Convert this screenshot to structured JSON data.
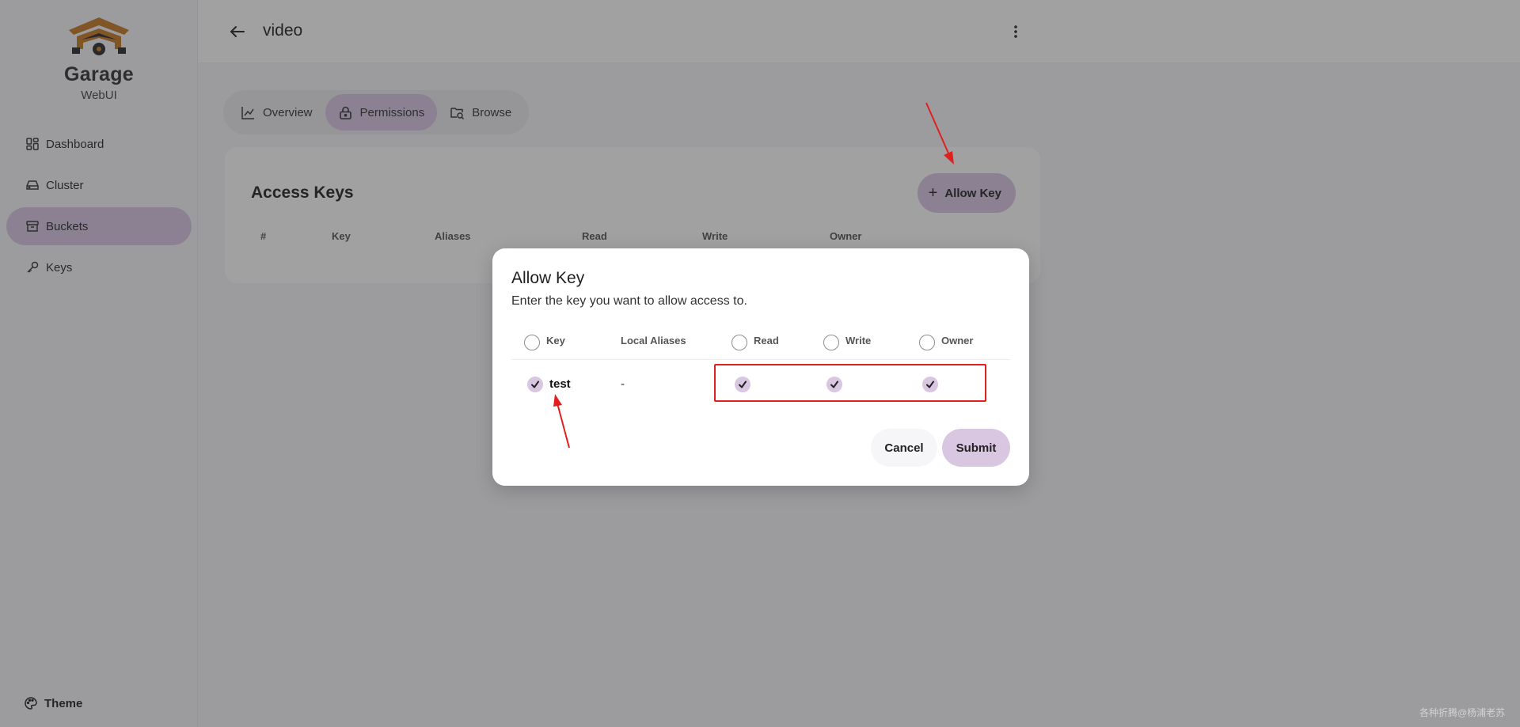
{
  "app": {
    "name": "Garage",
    "subtitle": "WebUI",
    "brand_color": "#c57a22",
    "accent_color": "#d9c7e2"
  },
  "sidebar": {
    "items": [
      {
        "label": "Dashboard",
        "icon": "dashboard-icon",
        "active": false
      },
      {
        "label": "Cluster",
        "icon": "hard-drive-icon",
        "active": false
      },
      {
        "label": "Buckets",
        "icon": "archive-box-icon",
        "active": true
      },
      {
        "label": "Keys",
        "icon": "key-icon",
        "active": false
      }
    ],
    "theme_label": "Theme",
    "theme_icon": "palette-icon"
  },
  "header": {
    "title": "video",
    "back_icon": "arrow-left-icon",
    "menu_icon": "more-vertical-icon"
  },
  "tabs": [
    {
      "label": "Overview",
      "icon": "chart-line-icon",
      "active": false
    },
    {
      "label": "Permissions",
      "icon": "lock-icon",
      "active": true
    },
    {
      "label": "Browse",
      "icon": "folder-search-icon",
      "active": false
    }
  ],
  "access_keys": {
    "title": "Access Keys",
    "allow_button_label": "Allow Key",
    "columns": [
      "#",
      "Key",
      "Aliases",
      "Read",
      "Write",
      "Owner"
    ]
  },
  "dialog": {
    "title": "Allow Key",
    "description": "Enter the key you want to allow access to.",
    "columns": [
      "Key",
      "Local Aliases",
      "Read",
      "Write",
      "Owner"
    ],
    "rows": [
      {
        "key": "test",
        "aliases": "-",
        "selected": true,
        "read": true,
        "write": true,
        "owner": true
      }
    ],
    "cancel_label": "Cancel",
    "submit_label": "Submit"
  },
  "annotation_color": "#e21f1f",
  "watermark": "各种折腾@杨浦老苏"
}
